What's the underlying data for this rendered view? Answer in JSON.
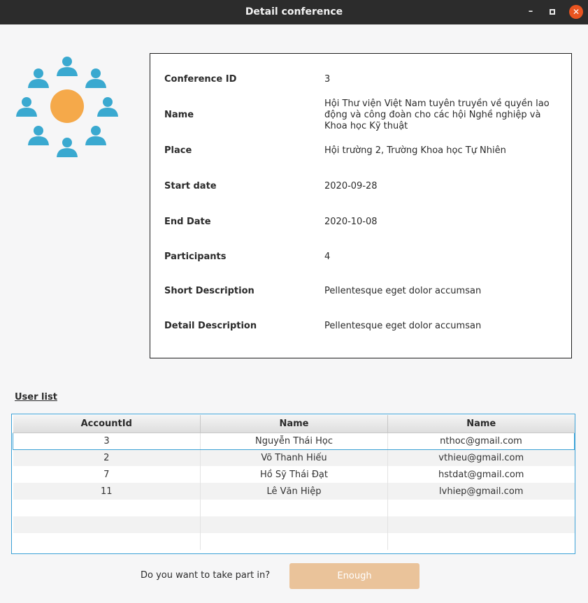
{
  "window": {
    "title": "Detail conference"
  },
  "logo": {
    "icon": "group-meeting-icon",
    "accent_color": "#f5a94a",
    "person_color": "#3aa9d0"
  },
  "conference": {
    "fields": [
      {
        "label": "Conference ID",
        "value": "3"
      },
      {
        "label": "Name",
        "value": "Hội Thư viện Việt Nam tuyên truyền về quyền lao động và công đoàn cho các hội Nghề nghiệp và Khoa học Kỹ thuật"
      },
      {
        "label": "Place",
        "value": "Hội trường 2, Trường Khoa học Tự Nhiên"
      },
      {
        "label": "Start date",
        "value": "2020-09-28"
      },
      {
        "label": "End Date",
        "value": "2020-10-08"
      },
      {
        "label": "Participants",
        "value": "4"
      },
      {
        "label": "Short Description",
        "value": "Pellentesque eget dolor accumsan"
      },
      {
        "label": "Detail Description",
        "value": "Pellentesque eget dolor accumsan"
      }
    ]
  },
  "user_list": {
    "label": "User list",
    "columns": [
      "AccountId",
      "Name",
      "Name"
    ],
    "rows": [
      [
        "3",
        "Nguyễn Thái Học",
        "nthoc@gmail.com"
      ],
      [
        "2",
        "Võ Thanh Hiếu",
        "vthieu@gmail.com"
      ],
      [
        "7",
        "Hồ Sỹ Thái Đạt",
        "hstdat@gmail.com"
      ],
      [
        "11",
        "Lê Văn Hiệp",
        "lvhiep@gmail.com"
      ],
      [
        "",
        "",
        ""
      ],
      [
        "",
        "",
        ""
      ],
      [
        "",
        "",
        ""
      ]
    ],
    "selected_row": 0
  },
  "footer": {
    "question": "Do you want to take part in?",
    "button_label": "Enough",
    "button_color": "#eac39a"
  }
}
